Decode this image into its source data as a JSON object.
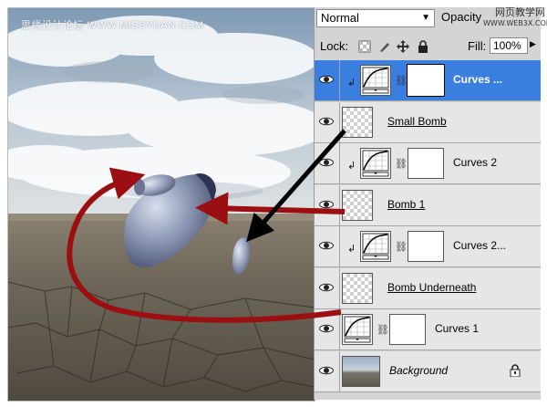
{
  "watermark": "思缘设计论坛 WWW.MISSYUAN.COM",
  "corner_watermark": {
    "line1": "网页教学网",
    "line2": "WWW.WEB3X.COM"
  },
  "panel": {
    "blend_mode": "Normal",
    "opacity_label": "Opacity",
    "lock_label": "Lock:",
    "fill_label": "Fill:",
    "fill_value": "100%"
  },
  "layers": [
    {
      "name": "Curves ...",
      "type": "adjustment",
      "selected": true,
      "clipped": true,
      "style": "bold"
    },
    {
      "name": "Small Bomb",
      "type": "pixel",
      "selected": false,
      "clipped": false,
      "style": "underline"
    },
    {
      "name": "Curves 2",
      "type": "adjustment",
      "selected": false,
      "clipped": true,
      "style": "normal"
    },
    {
      "name": "Bomb 1",
      "type": "pixel",
      "selected": false,
      "clipped": false,
      "style": "underline"
    },
    {
      "name": "Curves 2...",
      "type": "adjustment",
      "selected": false,
      "clipped": true,
      "style": "normal"
    },
    {
      "name": "Bomb Underneath",
      "type": "pixel",
      "selected": false,
      "clipped": false,
      "style": "underline"
    },
    {
      "name": "Curves 1",
      "type": "adjustment",
      "selected": false,
      "clipped": false,
      "style": "normal"
    },
    {
      "name": "Background",
      "type": "background",
      "selected": false,
      "clipped": false,
      "style": "italic",
      "locked": true
    }
  ],
  "colors": {
    "selection": "#3a7fe0",
    "annotation_red": "#9b0f12",
    "annotation_black": "#000000"
  }
}
